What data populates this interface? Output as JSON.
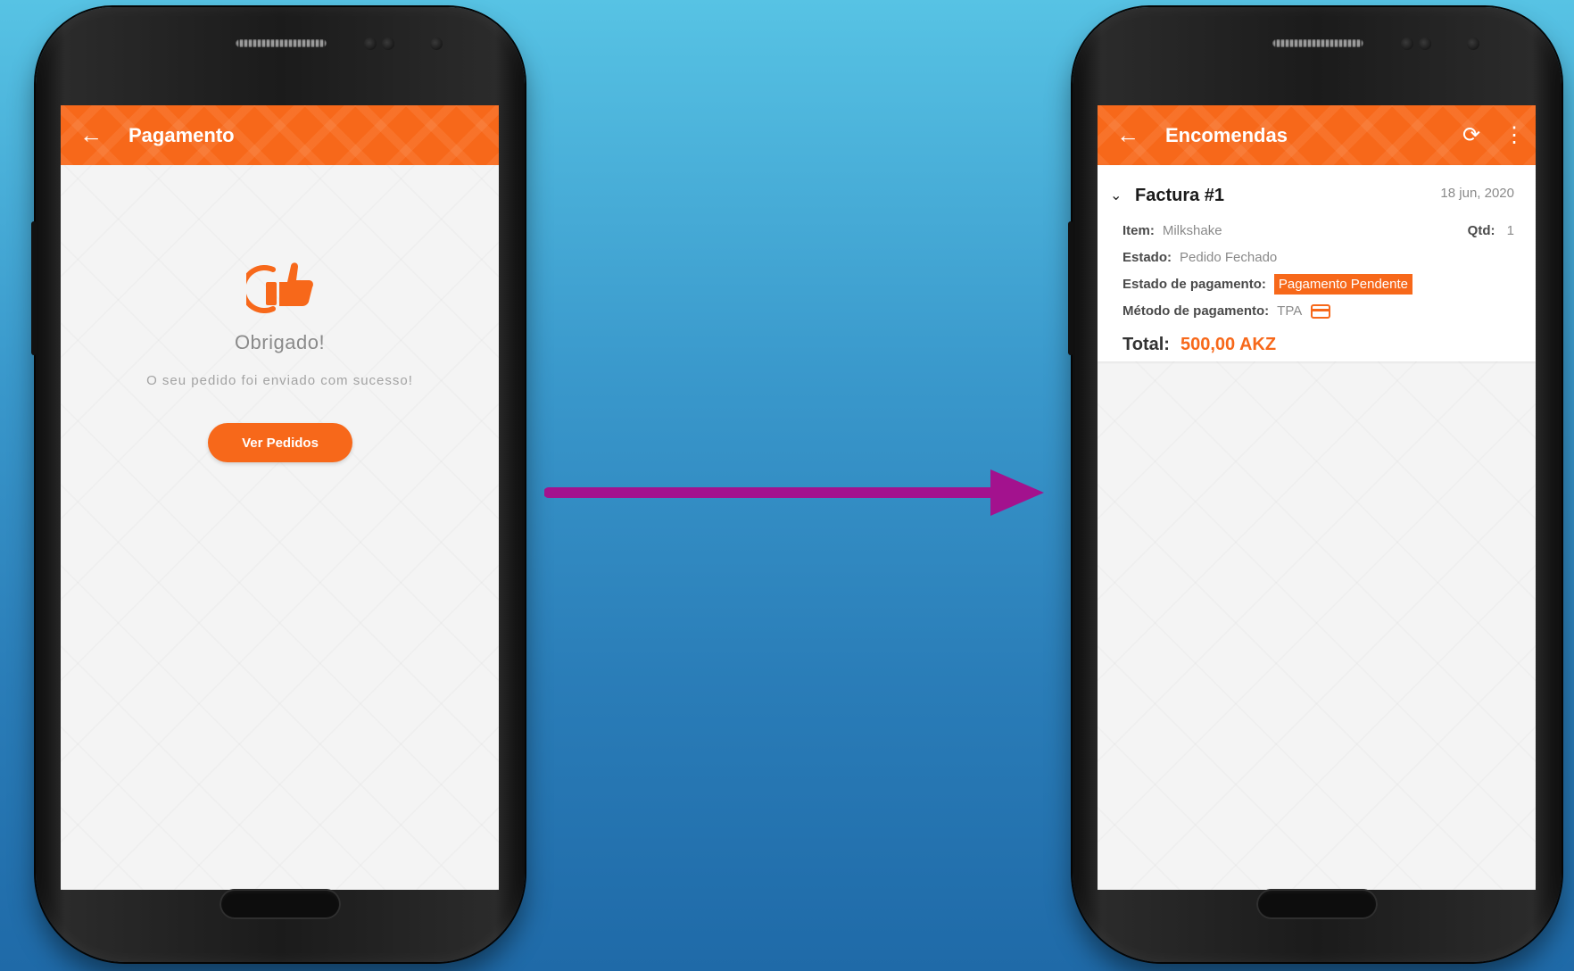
{
  "colors": {
    "accent": "#f7681a",
    "arrow": "#a3128e",
    "background_top": "#57c3e4",
    "background_bottom": "#1f6aa8"
  },
  "left_screen": {
    "appbar": {
      "back_icon": "arrow-left-icon",
      "back_glyph": "←",
      "title": "Pagamento"
    },
    "icon": "thumbs-up-icon",
    "heading": "Obrigado!",
    "message": "O seu pedido foi enviado com sucesso!",
    "button_label": "Ver Pedidos"
  },
  "right_screen": {
    "appbar": {
      "back_icon": "arrow-left-icon",
      "back_glyph": "←",
      "title": "Encomendas",
      "refresh_icon": "refresh-icon",
      "refresh_glyph": "⟳",
      "menu_icon": "more-vertical-icon",
      "menu_glyph": "⋮"
    },
    "invoice": {
      "chevron_glyph": "⌄",
      "title": "Factura #1",
      "date": "18 jun, 2020",
      "item_label": "Item:",
      "item_value": "Milkshake",
      "qty_label": "Qtd:",
      "qty_value": "1",
      "status_label": "Estado:",
      "status_value": "Pedido Fechado",
      "payment_status_label": "Estado de pagamento:",
      "payment_status_value": "Pagamento Pendente",
      "payment_method_label": "Método de pagamento:",
      "payment_method_value": "TPA",
      "payment_method_icon": "credit-card-icon",
      "total_label": "Total:",
      "total_value": "500,00 AKZ"
    }
  }
}
